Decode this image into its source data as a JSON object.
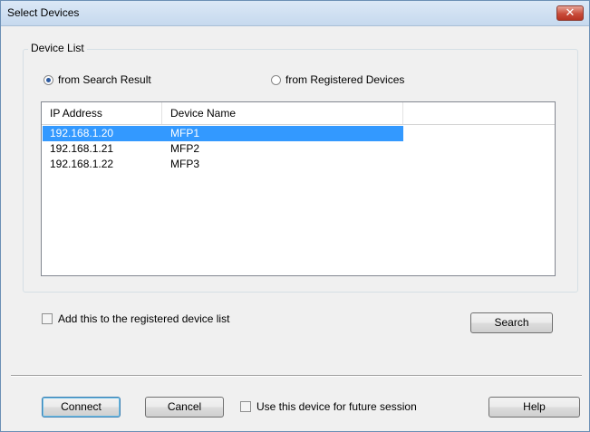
{
  "window": {
    "title": "Select Devices",
    "close_glyph": "✕"
  },
  "device_list": {
    "group_label": "Device List",
    "radio_search": {
      "label": "from Search Result",
      "checked": true
    },
    "radio_registered": {
      "label": "from Registered Devices",
      "checked": false
    },
    "columns": [
      "IP Address",
      "Device Name",
      ""
    ],
    "rows": [
      {
        "ip": "192.168.1.20",
        "name": "MFP1",
        "selected": true
      },
      {
        "ip": "192.168.1.21",
        "name": "MFP2",
        "selected": false
      },
      {
        "ip": "192.168.1.22",
        "name": "MFP3",
        "selected": false
      }
    ]
  },
  "add_registered": {
    "label": "Add this to the registered device list",
    "checked": false
  },
  "buttons": {
    "search": "Search",
    "connect": "Connect",
    "cancel": "Cancel",
    "help": "Help"
  },
  "use_future": {
    "label": "Use this device for future session",
    "checked": false
  },
  "colors": {
    "selection": "#3399ff",
    "close_button": "#c94c3a",
    "titlebar": "#c6d9ee"
  }
}
